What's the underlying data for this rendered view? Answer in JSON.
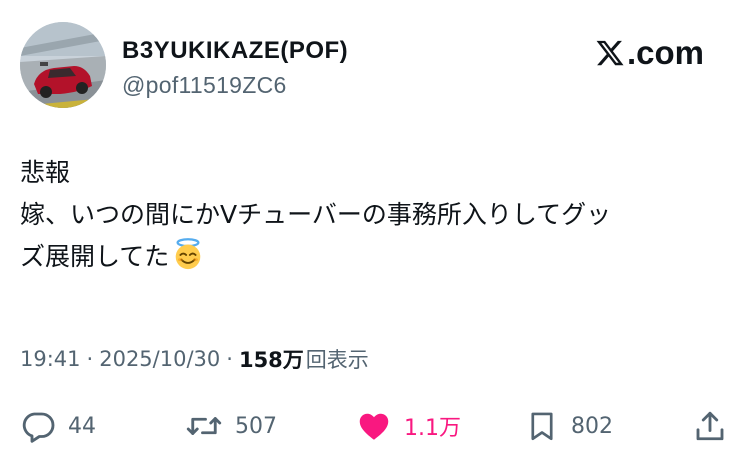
{
  "author": {
    "display_name": "B3YUKIKAZE(POF)",
    "handle": "@pof11519ZC6"
  },
  "brand": {
    "label": ".com",
    "icon": "x-logo-icon"
  },
  "tweet": {
    "lines": [
      "悲報",
      "嫁、いつの間にかVチューバーの事務所入りしてグッ",
      "ズ展開してた"
    ],
    "emoji": "smiling-face-with-halo-icon"
  },
  "meta": {
    "time": "19:41",
    "dot": "·",
    "date": "2025/10/30",
    "views_count": "158万",
    "views_label": "回表示"
  },
  "actions": {
    "replies": "44",
    "reposts": "507",
    "likes": "1.1万",
    "bookmarks": "802"
  },
  "colors": {
    "text": "#0f1419",
    "secondary": "#536471",
    "like": "#f91880"
  }
}
